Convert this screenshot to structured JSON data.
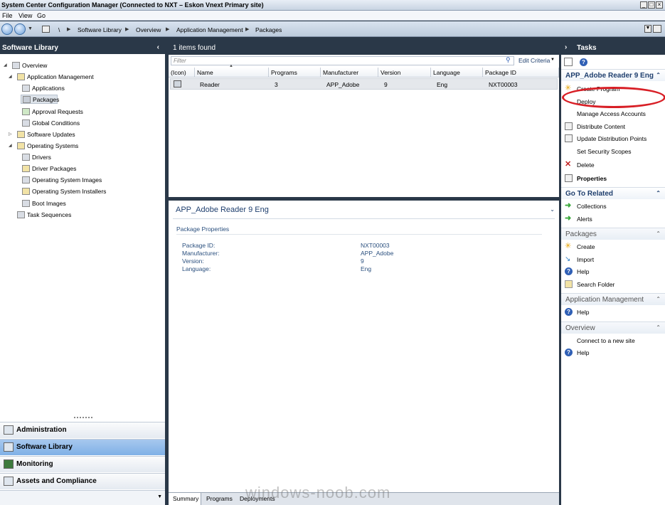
{
  "window": {
    "title": "System Center Configuration Manager (Connected to NXT – Eskon Vnext Primary site)"
  },
  "menu": [
    "File",
    "View",
    "Go"
  ],
  "breadcrumb": [
    "\\",
    "Software Library",
    "Overview",
    "Application Management",
    "Packages"
  ],
  "left": {
    "header": "Software Library",
    "tree": [
      {
        "label": "Overview",
        "icon": "overview-icon"
      },
      {
        "label": "Application Management",
        "icon": "folder-icon"
      },
      {
        "label": "Applications",
        "icon": "application-icon"
      },
      {
        "label": "Packages",
        "icon": "package-icon",
        "selected": true
      },
      {
        "label": "Approval Requests",
        "icon": "approval-icon"
      },
      {
        "label": "Global Conditions",
        "icon": "condition-icon"
      },
      {
        "label": "Software Updates",
        "icon": "folder-icon"
      },
      {
        "label": "Operating Systems",
        "icon": "folder-icon"
      },
      {
        "label": "Drivers",
        "icon": "driver-icon"
      },
      {
        "label": "Driver Packages",
        "icon": "driver-package-icon"
      },
      {
        "label": "Operating System Images",
        "icon": "os-image-icon"
      },
      {
        "label": "Operating System Installers",
        "icon": "os-installer-icon"
      },
      {
        "label": "Boot Images",
        "icon": "boot-image-icon"
      },
      {
        "label": "Task Sequences",
        "icon": "task-sequence-icon"
      }
    ],
    "workspaces": [
      "Administration",
      "Software Library",
      "Monitoring",
      "Assets and Compliance"
    ]
  },
  "list": {
    "count_text": "1 items found",
    "filter_placeholder": "Filter",
    "edit_criteria": "Edit Criteria",
    "columns": [
      "(Icon)",
      "Name",
      "Programs",
      "Manufacturer",
      "Version",
      "Language",
      "Package ID"
    ],
    "rows": [
      {
        "name": "Reader",
        "programs": "3",
        "manufacturer": "APP_Adobe",
        "version": "9",
        "language": "Eng",
        "package_id": "NXT00003"
      }
    ]
  },
  "detail": {
    "title": "APP_Adobe Reader 9 Eng",
    "section": "Package Properties",
    "props": [
      {
        "label": "Package ID:",
        "value": "NXT00003"
      },
      {
        "label": "Manufacturer:",
        "value": "APP_Adobe"
      },
      {
        "label": "Version:",
        "value": "9"
      },
      {
        "label": "Language:",
        "value": "Eng"
      }
    ],
    "tabs": [
      "Summary",
      "Programs",
      "Deployments"
    ]
  },
  "tasks": {
    "header": "Tasks",
    "selected_title": "APP_Adobe Reader 9 Eng",
    "selected_actions": [
      "Create Program",
      "Deploy",
      "Manage Access Accounts",
      "Distribute Content",
      "Update Distribution Points",
      "Set Security Scopes",
      "Delete",
      "Properties"
    ],
    "goto_title": "Go To Related",
    "goto_actions": [
      "Collections",
      "Alerts"
    ],
    "packages_title": "Packages",
    "packages_actions": [
      "Create",
      "Import",
      "Help",
      "Search Folder"
    ],
    "appmgmt_title": "Application Management",
    "appmgmt_actions": [
      "Help"
    ],
    "overview_title": "Overview",
    "overview_actions": [
      "Connect to a new site",
      "Help"
    ]
  },
  "watermark": "windows-noob.com",
  "colors": {
    "accent": "#1f3f6e",
    "highlight": "#d81f26",
    "chrome": "#2a3848"
  }
}
